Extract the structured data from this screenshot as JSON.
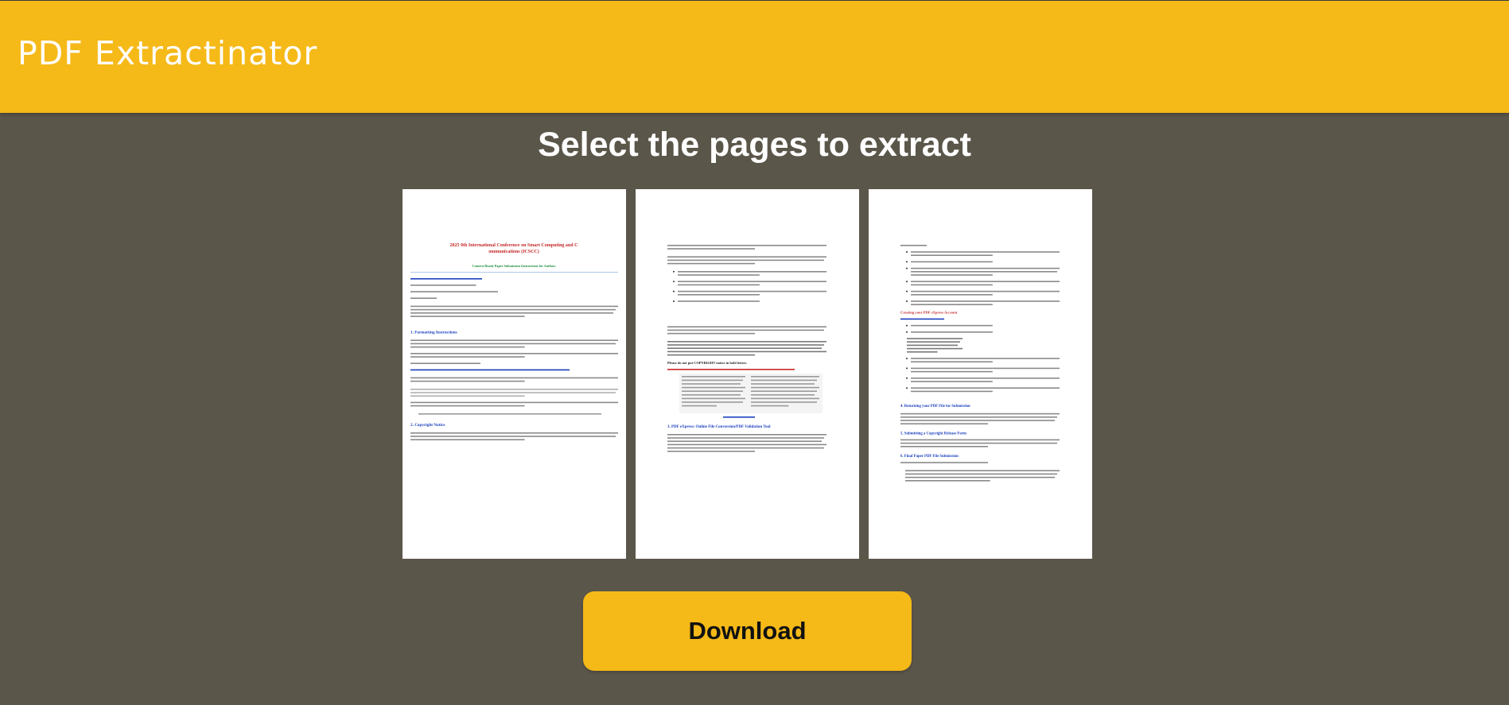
{
  "header": {
    "app_title": "PDF Extractinator"
  },
  "main": {
    "title": "Select the pages to extract",
    "download_label": "Download",
    "pages": [
      {
        "heading": "2025 9th International Conference on Smart Computing and Communications (ICSCC)",
        "subheading": "Camera-Ready Paper Submission Instructions for Authors",
        "section_1": "1. Formatting Instructions",
        "section_2": "2. Copyright Notice"
      },
      {
        "bold_line": "Please do not put COPYRIGHT notice in bold letters",
        "section_3": "3. PDF eXpress: Online File Conversion/PDF Validation Tool"
      },
      {
        "red_heading": "Creating your PDF eXpress Account",
        "section_4": "4. Returning your PDF File for Submission",
        "section_5": "5. Submitting a Copyright Release Form",
        "section_6": "6. Final Paper PDF File Submission"
      }
    ]
  },
  "colors": {
    "header_bg": "#f5b918",
    "page_bg": "#5b564a",
    "button_bg": "#f5b918",
    "doc_red": "#c62828",
    "doc_blue": "#1a3fbf",
    "doc_green": "#1e8e3e"
  }
}
